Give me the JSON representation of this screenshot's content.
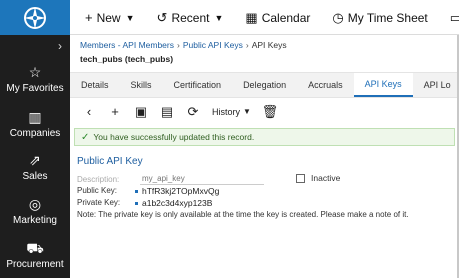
{
  "topnav": {
    "new": "New",
    "recent": "Recent",
    "calendar": "Calendar",
    "timesheet": "My Time Sheet"
  },
  "sidebar": {
    "items": [
      {
        "label": "My Favorites",
        "icon": "star-icon"
      },
      {
        "label": "Companies",
        "icon": "building-icon"
      },
      {
        "label": "Sales",
        "icon": "chart-icon"
      },
      {
        "label": "Marketing",
        "icon": "target-icon"
      },
      {
        "label": "Procurement",
        "icon": "cart-icon"
      }
    ]
  },
  "breadcrumb": {
    "item1": "Members - API Members",
    "item2": "Public API Keys",
    "item3": "API Keys"
  },
  "record_title": "tech_pubs (tech_pubs)",
  "tabs": [
    "Details",
    "Skills",
    "Certification",
    "Delegation",
    "Accruals",
    "API Keys",
    "API Lo"
  ],
  "active_tab": "API Keys",
  "toolbar": {
    "history": "History"
  },
  "alert": {
    "message": "You have successfully updated this record."
  },
  "form": {
    "section_title": "Public API Key",
    "description_label": "Description:",
    "description_placeholder": "my_api_key",
    "inactive_label": "Inactive",
    "public_key_label": "Public Key:",
    "public_key_value": "hTfR3kj2TOpMxvQg",
    "private_key_label": "Private Key:",
    "private_key_value": "a1b2c3d4xyp123B",
    "note": "Note: The private key is only available at the time the key is created. Please make a note of it."
  },
  "colors": {
    "brand": "#1d76bb",
    "sidebar": "#1e1e1e",
    "link": "#1f5fa0",
    "success_bg": "#eef7ea"
  }
}
